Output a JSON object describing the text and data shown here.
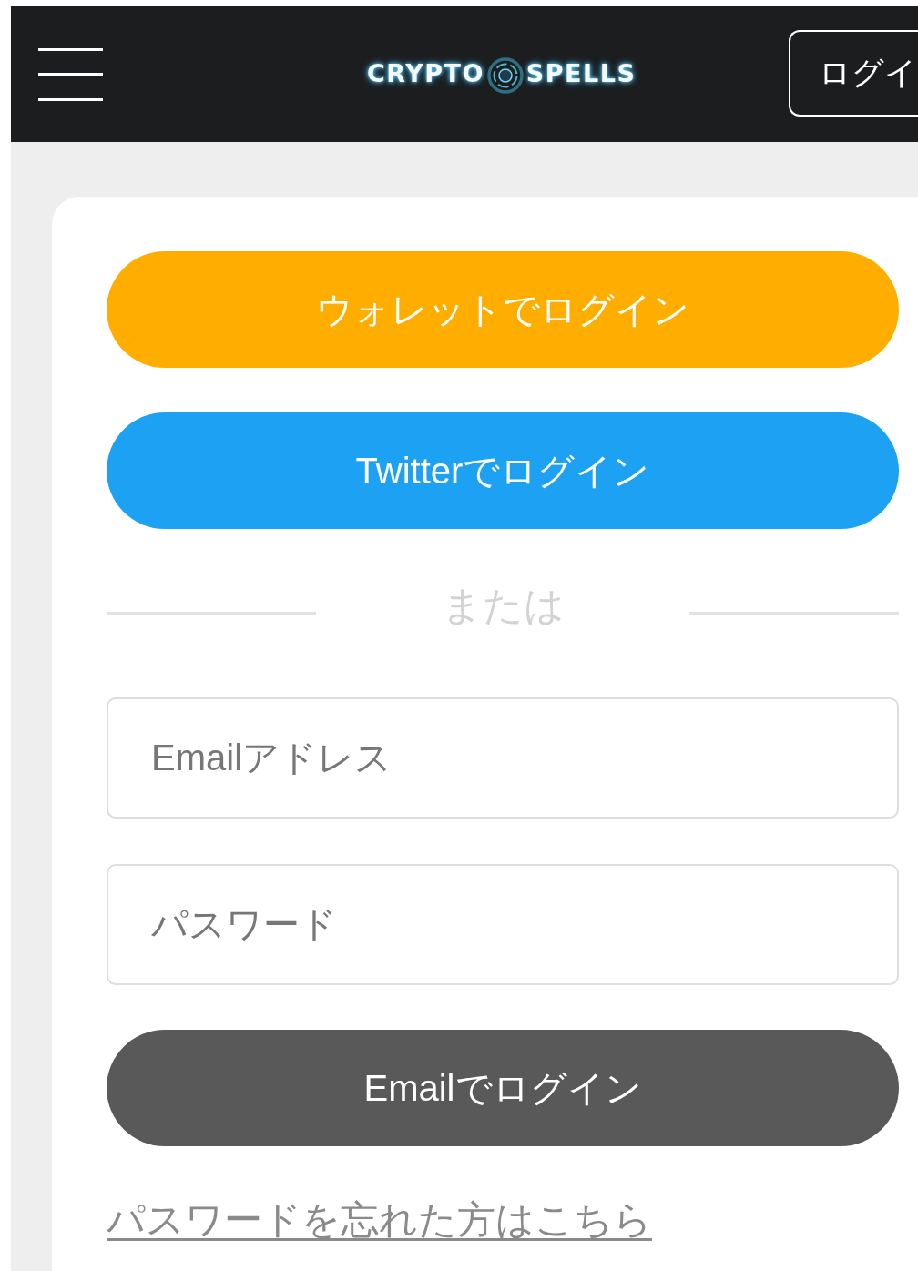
{
  "header": {
    "logo_words": [
      "CRYPTO",
      "SPELLS"
    ],
    "login_button": "ログイ"
  },
  "login_options": [
    {
      "kind": "wallet",
      "label": "ウォレットでログイン"
    },
    {
      "kind": "twitter",
      "label": "Twitterでログイン"
    }
  ],
  "separator": "または",
  "fields": [
    {
      "placeholder": "Emailアドレス"
    },
    {
      "placeholder": "パスワード"
    }
  ],
  "submit_button": "Emailでログイン",
  "forgot_link": "パスワードを忘れた方はこちら"
}
